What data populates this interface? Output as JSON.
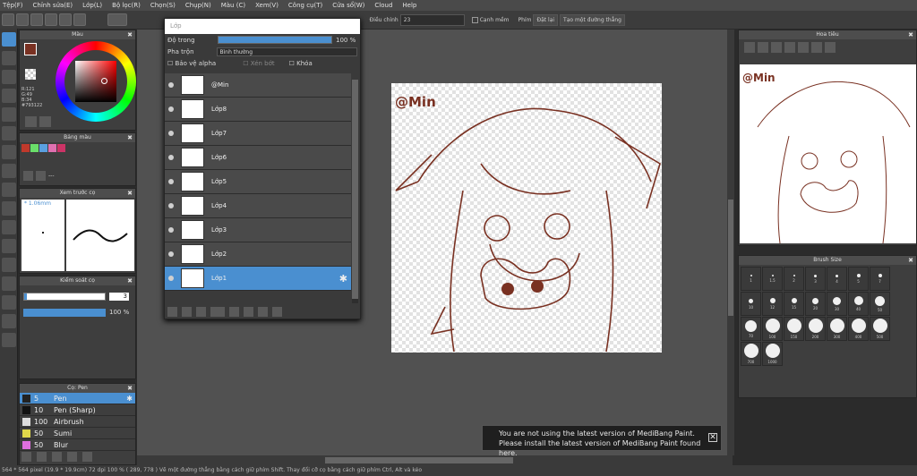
{
  "menu": [
    "Tệp(F)",
    "Chỉnh sửa(E)",
    "Lớp(L)",
    "Bộ lọc(R)",
    "Chọn(S)",
    "Chụp(N)",
    "Màu (C)",
    "Xem(V)",
    "Công cụ(T)",
    "Cửa sổ(W)",
    "Cloud",
    "Help"
  ],
  "toolbar": {
    "adjust_label": "Điều chỉnh",
    "adjust_value": "23",
    "smooth_label": "Cạnh mềm",
    "key_label": "Phím",
    "reset_label": "Đặt lại",
    "line_label": "Tạo một đường thẳng"
  },
  "color_panel": {
    "title": "Màu",
    "r": "R:121",
    "g": "G:49",
    "b": "B:34",
    "hex": "#793122",
    "primary": "#793122"
  },
  "palette_panel": {
    "title": "Bảng màu",
    "swatches": [
      "#c0392b",
      "#6adf6a",
      "#5aa0e0",
      "#e070b0",
      "#cc3366"
    ],
    "add_label": "---"
  },
  "preview_panel": {
    "title": "Xem trước cọ",
    "size": "1.06mm"
  },
  "control_panel": {
    "title": "Kiểm soát cọ",
    "size": "3",
    "opacity": "100 %"
  },
  "brush_panel": {
    "title": "Cọ: Pen",
    "items": [
      {
        "size": "5",
        "name": "Pen",
        "color": "#222222",
        "selected": true
      },
      {
        "size": "10",
        "name": "Pen (Sharp)",
        "color": "#111111"
      },
      {
        "size": "100",
        "name": "Airbrush",
        "color": "#dddddd"
      },
      {
        "size": "50",
        "name": "Sumi",
        "color": "#e0d84a"
      },
      {
        "size": "50",
        "name": "Blur",
        "color": "#e070e0"
      }
    ]
  },
  "layer_panel": {
    "title": "Lớp",
    "opacity_label": "Độ trong",
    "opacity_value": "100 %",
    "opacity_fraction": 1.0,
    "blend_label": "Pha trộn",
    "blend_value": "Bình thường",
    "protect_label": "Bảo vệ alpha",
    "clip_label": "Xén bớt",
    "lock_label": "Khóa",
    "layers": [
      "@Min",
      "Lớp8",
      "Lớp7",
      "Lớp6",
      "Lớp5",
      "Lớp4",
      "Lớp3",
      "Lớp2",
      "Lớp1"
    ],
    "selected": "Lớp1"
  },
  "canvas": {
    "watermark": "@Min"
  },
  "navigator": {
    "title": "Hoa tiêu",
    "watermark": "@Min"
  },
  "brush_size": {
    "title": "Brush Size",
    "sizes": [
      "1",
      "1.5",
      "2",
      "3",
      "4",
      "5",
      "7",
      "10",
      "12",
      "15",
      "20",
      "30",
      "40",
      "50",
      "70",
      "100",
      "150",
      "200",
      "300",
      "400",
      "500",
      "700",
      "1000"
    ]
  },
  "notice": {
    "line1": "You are not using the latest version of MediBang Paint.",
    "line2": "Please install the latest version of MediBang Paint found here."
  },
  "status": {
    "text": "564 * 564 pixel  (19.9 * 19.9cm)  72 dpi  100 %  ( 289, 778 )  Vẽ một đường thẳng bằng cách giữ phím Shift. Thay đổi cỡ cọ bằng cách giữ phím Ctrl, Alt và kéo"
  }
}
